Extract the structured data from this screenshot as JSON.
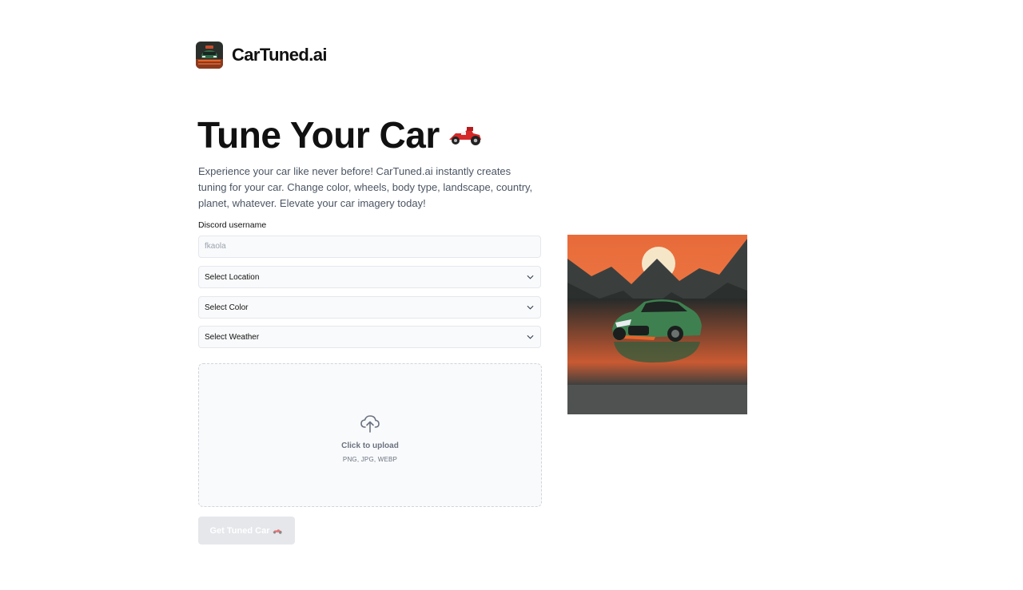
{
  "brand": {
    "name": "CarTuned.ai"
  },
  "hero": {
    "title": "Tune Your Car",
    "description": "Experience your car like never before! CarTuned.ai instantly creates tuning for your car. Change color, wheels, body type, landscape, country, planet, whatever. Elevate your car imagery today!"
  },
  "form": {
    "discord_label": "Discord username",
    "discord_placeholder": "fkaola",
    "location_select": "Select Location",
    "color_select": "Select Color",
    "weather_select": "Select Weather",
    "upload_title": "Click to upload",
    "upload_formats": "PNG, JPG, WEBP",
    "submit_label": "Get Tuned Car"
  },
  "icons": {
    "logo": "cartuned-logo",
    "race_car": "race-car-emoji",
    "chevron": "chevron-down-icon",
    "upload": "cloud-upload-icon"
  },
  "colors": {
    "field_bg": "#f9fafb",
    "field_border": "#e5e7eb",
    "button_disabled_bg": "#e5e7eb",
    "preview_sky": "#e9773f"
  }
}
